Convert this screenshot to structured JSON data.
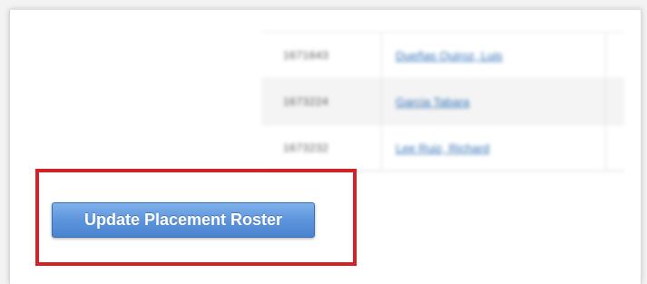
{
  "roster": {
    "rows": [
      {
        "id": "1671643",
        "name": "Dueñas Quiroz, Luis"
      },
      {
        "id": "1673224",
        "name": "Garcia Tabara"
      },
      {
        "id": "1673232",
        "name": "Lee Ruiz, Richard"
      }
    ]
  },
  "actions": {
    "update_label": "Update Placement Roster"
  },
  "colors": {
    "highlight": "#d42027",
    "button": "#5d95dc",
    "link": "#2f6fb5"
  }
}
